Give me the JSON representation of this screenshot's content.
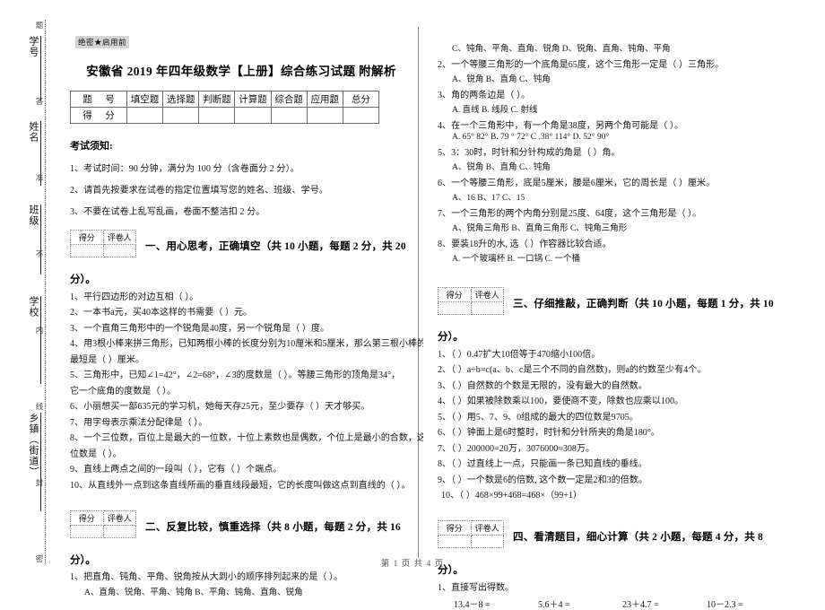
{
  "margin": {
    "secret_line_chars": [
      "题",
      "答",
      "准",
      "不",
      "内",
      "线",
      "封",
      "密"
    ],
    "fields": [
      {
        "label": "学号"
      },
      {
        "label": "姓名"
      },
      {
        "label": "班级"
      },
      {
        "label": "学校"
      },
      {
        "label": "乡镇（街道）"
      }
    ]
  },
  "header": {
    "secret_mark": "绝密★启用前",
    "title": "安徽省 2019 年四年级数学【上册】综合练习试题 附解析"
  },
  "score_table": {
    "row_header_label": "题  号",
    "row_score_label": "得  分",
    "columns": [
      "填空题",
      "选择题",
      "判断题",
      "计算题",
      "综合题",
      "应用题",
      "总分"
    ]
  },
  "notice": {
    "title": "考试须知:",
    "items": [
      "1、考试时间：90 分钟，满分为 100 分（含卷面分 2 分）。",
      "2、请首先按要求在试卷的指定位置填写您的姓名、班级、学号。",
      "3、不要在试卷上乱写乱画，卷面不整洁扣 2 分。"
    ]
  },
  "score_box": {
    "score_label": "得分",
    "grader_label": "评卷人"
  },
  "sections": [
    {
      "id": "fill-blank",
      "title_line1": "一、用心思考，正确填空（共 10 小题，每题 2 分，共 20",
      "title_line2": "分）。",
      "questions": [
        "1、平行四边形的对边互相（        ）。",
        "2、一本书a元，买40本这样的书需要（        ）元。",
        "3、一个直角三角形中的一个锐角是40度，另一个锐角是（      ）度。",
        "4、用3根小棒来拼三角形，已知两根小棒的长度分别为10厘米和5厘米，那么第三根小棒的长度",
        "最短是（      ）厘米。",
        "5、三角形中，已知∠1=42°，∠2=68°，∠3的度数是（      ）。等腰三角形的顶角是34°，",
        "它一个底角的度数是（      ）。",
        "6、小丽想买一部635元的学习机，她每天存25元，至少要存（      ）天才够买。",
        "7、用字母表示乘法分配律是（                ）。",
        "8、一个三位数，百位上是最大的一位数，十位上素数也是偶数，个位上是最小的合数，这个三",
        "位数是（        ）。",
        "9、直线上两点之间的一段叫（      ），它有（      ）个端点。",
        "10、从直线外一点到这条直线所画的垂直线段最短，它的长度叫做这点到直线的（        ）。"
      ]
    },
    {
      "id": "multiple-choice",
      "title_line1": "二、反复比较，慎重选择（共 8 小题，每题 2 分，共 16",
      "title_line2": "分）。",
      "questions": [
        {
          "stem": "1、把直角、钝角、平角、锐角按从大到小的顺序排列起来的是（      ）。",
          "options": "A、直角、锐角、平角、钝角          B、平角、钝角、直角、锐角"
        }
      ]
    }
  ],
  "right_column": {
    "mc_continued": [
      {
        "opts": "C、钝角、平角、直角、锐角            D、锐角、直角、钝角、平角"
      },
      {
        "stem": "2、一个等腰三角形的一个底角是65度，这个三角形一定是（     ）三角形。",
        "opts": "A、锐角          B、直角          C、钝角"
      },
      {
        "stem": "3、角的两条边是（      ）。",
        "opts": "A. 直线          B. 线段          C. 射线"
      },
      {
        "stem": "4、在一个三角形中，有一个角是38度，另两个角可能是（        ）。",
        "opts": "A. 65°  82°      B. 79 °  72°      C .38°   114°      D. 52°   90°"
      },
      {
        "stem": "5、3：30时，时针和分针构成的角是（        ）角。",
        "opts": "A、锐角                  B、直角                  C、钝角"
      },
      {
        "stem": "6、一个等腰三角形，底是5厘米，腰是6厘米，它的周长是（        ）厘米。",
        "opts": "A、16            B、17          C、15"
      },
      {
        "stem": "7、一个三角形的两个内角分别是25度、64度，这个三角形是（        ）。",
        "opts": "A、锐角三角形        B、直角三角形        C、钝角三角形"
      },
      {
        "stem": "8、要装18升的水, 选（      ）作容器比较合适。",
        "opts": "A.  一个玻璃杯              B.  一口锅                C.  一个桶"
      }
    ],
    "judge_section": {
      "title_line1": "三、仔细推敲，正确判断（共 10 小题，每题 1 分，共 10",
      "title_line2": "分）。",
      "questions": [
        "1、（        ）0.47扩大10倍等于470缩小100倍。",
        "2、（        ）a÷b=c(a、b、c是三个不同的自然数)，则a的约数至少有4个。",
        "3、（        ）自然数的个数是无限的，没有最大的自然数。",
        "4、（        ）如果被除数乘以100，要使商不变，除数也应乘以100。",
        "5、（        ）用5、7、9、0组成的最大的四位数是9705。",
        "6、（        ）钟面上是6时整时，时针和分针所夹的角是180°。",
        "7、（        ）200000=20万，3076000≈308万。",
        "8、（        ）过直线上一点，只能画一条已知直线的垂线。",
        "9、（        ）一个数是6的倍数, 这个数一定是2和3的倍数。",
        "10、（        ）468×99+468=468×（99+1）"
      ]
    },
    "calc_section": {
      "title_line1": "四、看清题目，细心计算（共 2 小题，每题 4 分，共 8",
      "title_line2": "分）。",
      "q1": "1、直接写出得数。",
      "items": [
        "13.4－8 =",
        "5.6＋4 =",
        "23＋4.7 =",
        "10－2.3 ="
      ]
    }
  },
  "footer": "第 1 页 共 4 页"
}
